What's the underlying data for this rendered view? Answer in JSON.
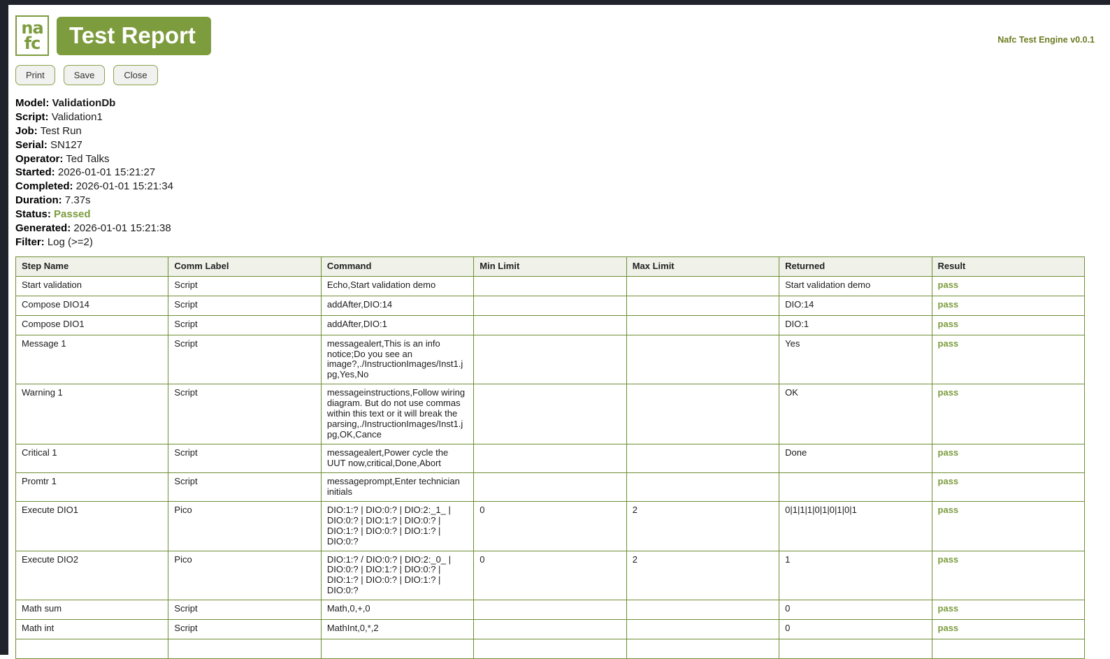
{
  "app": {
    "logo_line1": "na",
    "logo_line2": "fc",
    "title": "Test Report",
    "version": "Nafc Test Engine v0.0.1"
  },
  "toolbar": {
    "print_label": "Print",
    "save_label": "Save",
    "close_label": "Close"
  },
  "metadata": [
    {
      "label": "Model:",
      "value": "ValidationDb",
      "value_bold": true
    },
    {
      "label": "Script:",
      "value": "Validation1"
    },
    {
      "label": "Job:",
      "value": "Test Run"
    },
    {
      "label": "Serial:",
      "value": "SN127"
    },
    {
      "label": "Operator:",
      "value": "Ted Talks"
    },
    {
      "label": "Started:",
      "value": "2026-01-01 15:21:27"
    },
    {
      "label": "Completed:",
      "value": "2026-01-01 15:21:34"
    },
    {
      "label": "Duration:",
      "value": "7.37s"
    },
    {
      "label": "Status:",
      "value": "Passed",
      "status": true
    },
    {
      "label": "Generated:",
      "value": "2026-01-01 15:21:38"
    },
    {
      "label": "Filter:",
      "value": "Log (>=2)"
    }
  ],
  "table": {
    "columns": [
      "Step Name",
      "Comm Label",
      "Command",
      "Min Limit",
      "Max Limit",
      "Returned",
      "Result"
    ],
    "rows": [
      [
        "Start validation",
        "Script",
        "Echo,Start validation demo",
        "",
        "",
        "Start validation demo",
        "pass"
      ],
      [
        "Compose DIO14",
        "Script",
        "addAfter,DIO:14",
        "",
        "",
        "DIO:14",
        "pass"
      ],
      [
        "Compose DIO1",
        "Script",
        "addAfter,DIO:1",
        "",
        "",
        "DIO:1",
        "pass"
      ],
      [
        "Message 1",
        "Script",
        "messagealert,This is an info notice;Do you see an image?,./InstructionImages/Inst1.jpg,Yes,No",
        "",
        "",
        "Yes",
        "pass"
      ],
      [
        "Warning 1",
        "Script",
        "messageinstructions,Follow wiring diagram. But do not use commas within this text or it will break the parsing,./InstructionImages/Inst1.jpg,OK,Cance",
        "",
        "",
        "OK",
        "pass"
      ],
      [
        "Critical 1",
        "Script",
        "messagealert,Power cycle the UUT now,critical,Done,Abort",
        "",
        "",
        "Done",
        "pass"
      ],
      [
        "Promtr 1",
        "Script",
        "messageprompt,Enter technician initials",
        "",
        "",
        "",
        "pass"
      ],
      [
        "Execute DIO1",
        "Pico",
        "DIO:1:? | DIO:0:? | DIO:2:_1_ | DIO:0:? | DIO:1:? | DIO:0:? | DIO:1:? | DIO:0:? | DIO:1:? | DIO:0:?",
        "0",
        "2",
        "0|1|1|1|0|1|0|1|0|1",
        "pass"
      ],
      [
        "Execute DIO2",
        "Pico",
        "DIO:1:? / DIO:0:? | DIO:2:_0_ | DIO:0:? | DIO:1:? | DIO:0:? | DIO:1:? | DIO:0:? | DIO:1:? | DIO:0:?",
        "0",
        "2",
        "1",
        "pass"
      ],
      [
        "Math sum",
        "Script",
        "Math,0,+,0",
        "",
        "",
        "0",
        "pass"
      ],
      [
        "Math int",
        "Script",
        "MathInt,0,*,2",
        "",
        "",
        "0",
        "pass"
      ]
    ]
  },
  "colors": {
    "accent": "#7d9c3e",
    "pass_text": "#7d9c3e",
    "table_border": "#6f8e33",
    "header_bg": "#f0f1e9",
    "frame": "#20222c"
  }
}
